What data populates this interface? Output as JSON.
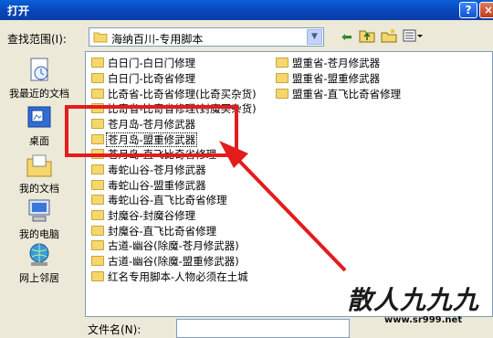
{
  "window": {
    "title": "打开",
    "help_label": "?",
    "close_label": "×"
  },
  "lookin": {
    "label": "查找范围(I):",
    "value": "海纳百川-专用脚本"
  },
  "places": [
    {
      "label": "我最近的文档",
      "icon": "recent-documents-icon"
    },
    {
      "label": "桌面",
      "icon": "desktop-icon"
    },
    {
      "label": "我的文档",
      "icon": "my-documents-icon"
    },
    {
      "label": "我的电脑",
      "icon": "my-computer-icon"
    },
    {
      "label": "网上邻居",
      "icon": "network-places-icon"
    }
  ],
  "files": {
    "col1": [
      "白日门-白日门修理",
      "白日门-比奇省修理",
      "比奇省-比奇省修理(比奇买杂货)",
      "比奇省-比奇省修理(封魔买杂货)",
      "苍月岛-苍月修武器",
      "苍月岛-盟重修武器",
      "苍月岛-直飞比奇省修理",
      "毒蛇山谷-苍月修武器",
      "毒蛇山谷-盟重修武器",
      "毒蛇山谷-直飞比奇省修理",
      "封魔谷-封魔谷修理",
      "封魔谷-直飞比奇省修理",
      "古道-幽谷(除魔-苍月修武器)",
      "古道-幽谷(除魔-盟重修武器)",
      "红名专用脚本-人物必须在土城"
    ],
    "col2": [
      "盟重省-苍月修武器",
      "盟重省-盟重修武器",
      "盟重省-直飞比奇省修理"
    ]
  },
  "filename": {
    "label": "文件名(N):",
    "value": ""
  },
  "watermark": {
    "main": "散人九九九",
    "site": "www.sr999.net"
  },
  "colors": {
    "annotation": "#e41c1c",
    "title_bar": "#0a5fd8"
  }
}
